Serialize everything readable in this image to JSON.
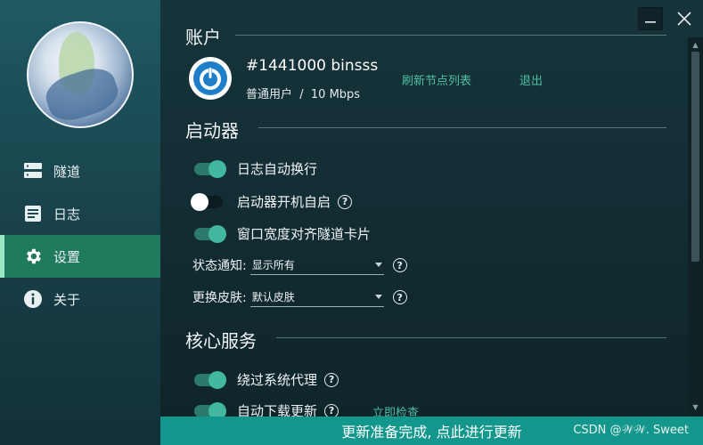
{
  "sidebar": {
    "items": [
      {
        "label": "隧道",
        "icon": "server-icon"
      },
      {
        "label": "日志",
        "icon": "document-icon"
      },
      {
        "label": "设置",
        "icon": "gear-icon",
        "active": true
      },
      {
        "label": "关于",
        "icon": "info-icon"
      }
    ]
  },
  "account": {
    "title": "账户",
    "name": "#1441000 binsss",
    "sub": "普通用户  /  10 Mbps",
    "refresh_link": "刷新节点列表",
    "logout_link": "退出"
  },
  "launcher": {
    "title": "启动器",
    "toggles": [
      {
        "label": "日志自动换行",
        "on": true,
        "help": false
      },
      {
        "label": "启动器开机自启",
        "on": false,
        "help": true
      },
      {
        "label": "窗口宽度对齐隧道卡片",
        "on": true,
        "help": false
      }
    ],
    "status_notify": {
      "label": "状态通知:",
      "value": "显示所有"
    },
    "skin": {
      "label": "更换皮肤:",
      "value": "默认皮肤"
    }
  },
  "core": {
    "title": "核心服务",
    "toggles": [
      {
        "label": "绕过系统代理",
        "on": true,
        "help": true
      },
      {
        "label": "自动下载更新",
        "on": true,
        "help": true
      }
    ],
    "check_now": "立即检查"
  },
  "help_glyph": "?",
  "update_bar": "更新准备完成, 点此进行更新",
  "watermark": "CSDN @𝒲𝒲. Sweet",
  "colors": {
    "accent": "#42b8a0",
    "active_nav": "#1f7a5e",
    "update_bar": "#13978c"
  }
}
